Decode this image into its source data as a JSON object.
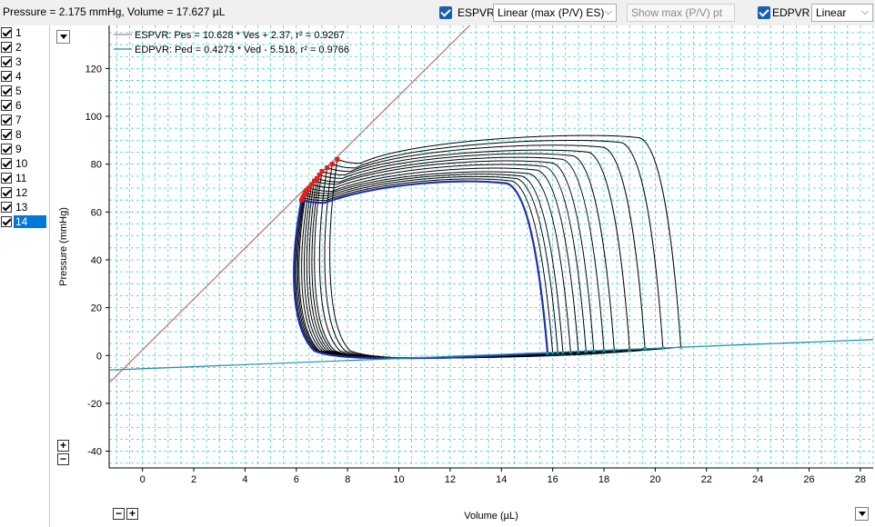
{
  "readout": "Pressure = 2.175 mmHg, Volume = 17.627 µL",
  "toolbar": {
    "espvr_label": "ESPVR",
    "espvr_mode": "Linear (max (P/V) ES)",
    "show_mode": "Show max (P/V) pt",
    "edpvr_label": "EDPVR",
    "edpvr_mode": "Linear"
  },
  "loops": [
    "1",
    "2",
    "3",
    "4",
    "5",
    "6",
    "7",
    "8",
    "9",
    "10",
    "11",
    "12",
    "13",
    "14"
  ],
  "selected_loop": "14",
  "colors": {
    "grid": "#3fd0d6",
    "espvr": "#c0504d",
    "edpvr": "#1f8fa8",
    "loop": "#000000",
    "selected_loop": "#1f2fa8",
    "es_point": "#e0201a",
    "ed_point": "#29b6d8"
  },
  "chart_data": {
    "type": "line",
    "xlabel": "Volume (µL)",
    "ylabel": "Pressure (mmHg)",
    "xlim": [
      -1.3,
      28.5
    ],
    "ylim": [
      -47,
      138
    ],
    "xticks": [
      0,
      2,
      4,
      6,
      8,
      10,
      12,
      14,
      16,
      18,
      20,
      22,
      24,
      26,
      28
    ],
    "yticks": [
      -40,
      -20,
      0,
      20,
      40,
      60,
      80,
      100,
      120
    ],
    "grid": true,
    "legend_position": "top-left",
    "espvr": {
      "label": "ESPVR: Pes = 10.628 * Ves + 2.37, r² = 0.9267",
      "slope": 10.628,
      "intercept": 2.37
    },
    "edpvr": {
      "label": "EDPVR: Ped = 0.4273 * Ved - 5.518, r² = 0.9766",
      "slope": 0.4273,
      "intercept": -5.518
    },
    "loops": [
      {
        "name": "1",
        "ved": 21.0,
        "ped": 3.5,
        "ves": 7.6,
        "pes": 82,
        "pmax": 91
      },
      {
        "name": "2",
        "ved": 20.3,
        "ped": 3.2,
        "ves": 7.4,
        "pes": 80,
        "pmax": 89
      },
      {
        "name": "3",
        "ved": 19.6,
        "ped": 2.9,
        "ves": 7.2,
        "pes": 78.5,
        "pmax": 87
      },
      {
        "name": "4",
        "ved": 19.0,
        "ped": 2.6,
        "ves": 7.0,
        "pes": 77,
        "pmax": 85
      },
      {
        "name": "5",
        "ved": 18.4,
        "ped": 2.4,
        "ves": 6.9,
        "pes": 75.5,
        "pmax": 83.5
      },
      {
        "name": "6",
        "ved": 18.0,
        "ped": 2.2,
        "ves": 6.8,
        "pes": 74,
        "pmax": 82
      },
      {
        "name": "7",
        "ved": 17.6,
        "ped": 2.0,
        "ves": 6.7,
        "pes": 73,
        "pmax": 80.5
      },
      {
        "name": "8",
        "ved": 17.3,
        "ped": 1.8,
        "ves": 6.6,
        "pes": 71.5,
        "pmax": 79
      },
      {
        "name": "9",
        "ved": 17.0,
        "ped": 1.6,
        "ves": 6.5,
        "pes": 70,
        "pmax": 77.5
      },
      {
        "name": "10",
        "ved": 16.7,
        "ped": 1.4,
        "ves": 6.4,
        "pes": 69,
        "pmax": 76
      },
      {
        "name": "11",
        "ved": 16.4,
        "ped": 1.3,
        "ves": 6.35,
        "pes": 68,
        "pmax": 75
      },
      {
        "name": "12",
        "ved": 16.2,
        "ped": 1.2,
        "ves": 6.3,
        "pes": 67,
        "pmax": 74
      },
      {
        "name": "13",
        "ved": 16.0,
        "ped": 1.1,
        "ves": 6.25,
        "pes": 66,
        "pmax": 73
      },
      {
        "name": "14",
        "ved": 15.8,
        "ped": 1.0,
        "ves": 6.2,
        "pes": 65,
        "pmax": 72
      }
    ]
  }
}
